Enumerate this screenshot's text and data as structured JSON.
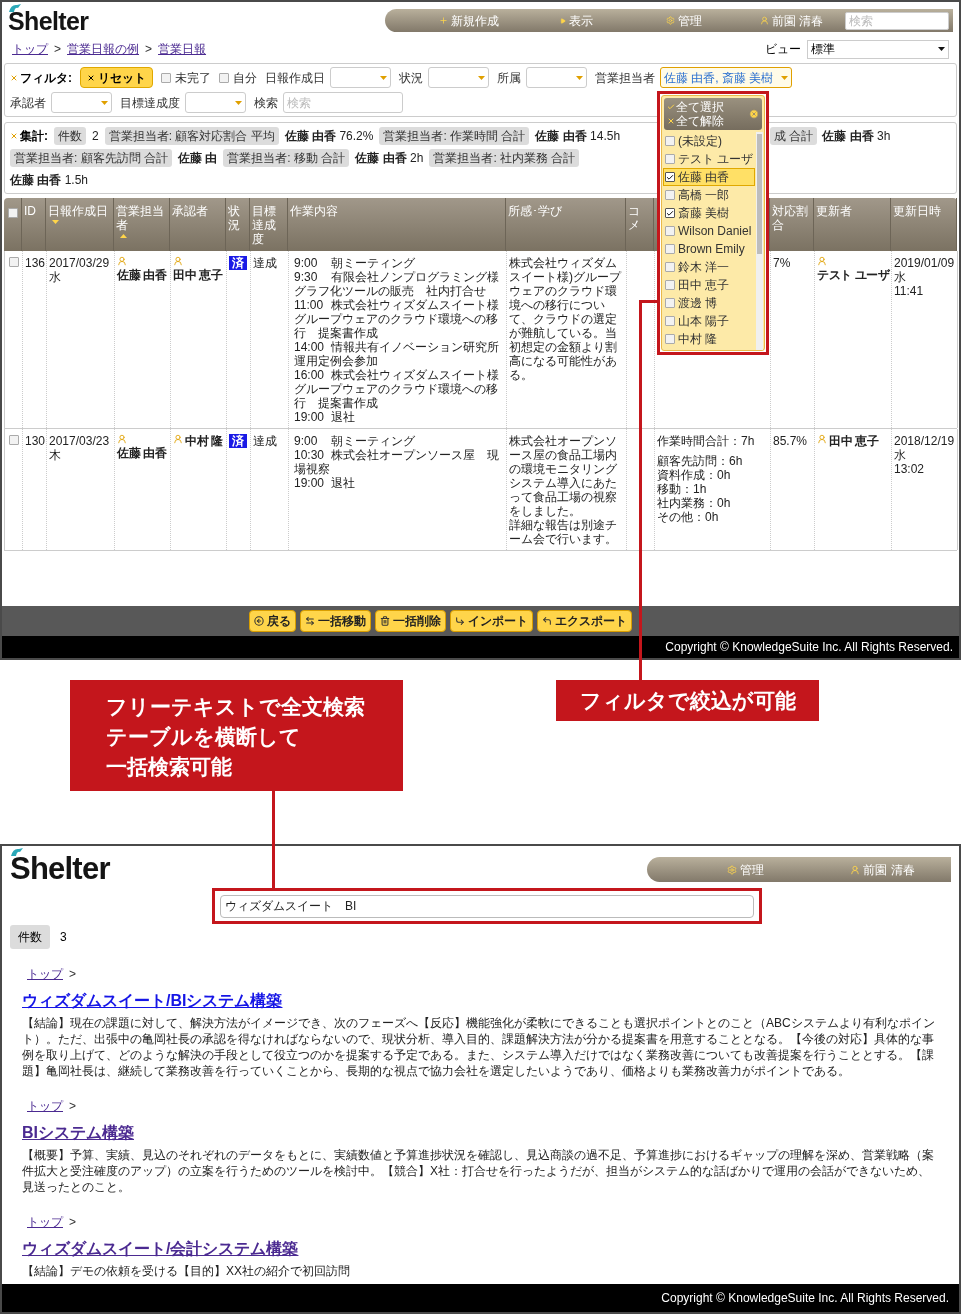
{
  "top_screen": {
    "logo": "Shelter",
    "nav": [
      {
        "kind": "new",
        "label": "新規作成"
      },
      {
        "kind": "view",
        "label": "表示"
      },
      {
        "kind": "admin",
        "label": "管理"
      },
      {
        "kind": "user",
        "label": "前園 清春"
      }
    ],
    "nav_search": {
      "placeholder": "検索"
    },
    "breadcrumb": [
      {
        "kind": "link",
        "text": "トップ"
      },
      {
        "kind": "separator",
        "text": ">"
      },
      {
        "kind": "link",
        "text": "営業日報の例"
      },
      {
        "kind": "separator",
        "text": ">"
      },
      {
        "kind": "link",
        "text": "営業日報"
      }
    ],
    "view": {
      "label": "ビュー",
      "value": "標準"
    },
    "filter": {
      "title": "フィルタ:",
      "reset": "リセット",
      "fields": [
        {
          "kind": "checkbox",
          "label": "未完了",
          "checked": false
        },
        {
          "kind": "checkbox",
          "label": "自分",
          "checked": false
        },
        {
          "kind": "select",
          "label": "日報作成日",
          "open": false
        },
        {
          "kind": "select",
          "label": "状況",
          "open": false
        },
        {
          "kind": "select",
          "label": "所属",
          "open": false
        },
        {
          "kind": "select",
          "label": "営業担当者",
          "value": "佐藤 由香, 斎藤 美樹",
          "open": true
        },
        {
          "kind": "select",
          "label": "承認者",
          "open": false
        },
        {
          "kind": "select",
          "label": "目標達成度",
          "open": false
        },
        {
          "kind": "text",
          "label": "検索",
          "placeholder": "検索"
        }
      ]
    },
    "dropdown": {
      "select_all": "全て選択",
      "clear_all": "全て解除",
      "options": [
        {
          "label": "(未設定)",
          "checked": false,
          "highlighted": false
        },
        {
          "label": "テスト ユーザ",
          "checked": false,
          "highlighted": false
        },
        {
          "label": "佐藤 由香",
          "checked": true,
          "highlighted": true
        },
        {
          "label": "高橋 一郎",
          "checked": false,
          "highlighted": false
        },
        {
          "label": "斎藤 美樹",
          "checked": true,
          "highlighted": false
        },
        {
          "label": "Wilson Daniel",
          "checked": false,
          "highlighted": false
        },
        {
          "label": "Brown Emily",
          "checked": false,
          "highlighted": false
        },
        {
          "label": "鈴木 洋一",
          "checked": false,
          "highlighted": false
        },
        {
          "label": "田中 恵子",
          "checked": false,
          "highlighted": false
        },
        {
          "label": "渡邊 博",
          "checked": false,
          "highlighted": false
        },
        {
          "label": "山本 陽子",
          "checked": false,
          "highlighted": false
        },
        {
          "label": "中村 隆",
          "checked": false,
          "highlighted": false
        }
      ]
    },
    "summary": {
      "title": "集計:",
      "row1_left": [
        {
          "kind": "chip",
          "text": "件数"
        },
        {
          "kind": "value",
          "text": "2"
        },
        {
          "kind": "chip",
          "text": "営業担当者: 顧客対応割合 平均"
        },
        {
          "kind": "value",
          "text": "**佐藤 由香** 76.2%"
        },
        {
          "kind": "chip",
          "text": "営業担当者: 作業時間 合計"
        },
        {
          "kind": "value",
          "text": "**佐藤 由香** 14.5h"
        },
        {
          "kind": "chip",
          "text": "営業担当者: 顧客先訪問 合計"
        },
        {
          "kind": "value",
          "text": "**佐藤 由**"
        }
      ],
      "row1_right": [
        {
          "kind": "chip",
          "text": "成 合計"
        },
        {
          "kind": "value",
          "text": "**佐藤 由香** 3h"
        }
      ],
      "row2": [
        {
          "kind": "chip",
          "text": "営業担当者: 移動 合計"
        },
        {
          "kind": "value",
          "text": "**佐藤 由香** 2h"
        },
        {
          "kind": "chip",
          "text": "営業担当者: 社内業務 合計"
        },
        {
          "kind": "value",
          "text": "**佐藤 由香** 1.5h"
        }
      ]
    },
    "table": {
      "all_checked": false,
      "columns": [
        {
          "label": "ID",
          "sorted": false
        },
        {
          "label": "日報作成日",
          "sorted": true,
          "ascending": false
        },
        {
          "label": "営業担当者",
          "sorted": true,
          "ascending": true
        },
        {
          "label": "承認者",
          "sorted": false
        },
        {
          "label": "状況",
          "sorted": false
        },
        {
          "label": "目標達成度",
          "sorted": false
        },
        {
          "label": "作業内容",
          "sorted": false
        },
        {
          "label": "所感･学び",
          "sorted": false
        },
        {
          "label": "コメ",
          "sorted": false
        },
        {
          "sorted": false
        },
        {
          "label": "対応割合",
          "sorted": false
        },
        {
          "label": "更新者",
          "sorted": false
        },
        {
          "label": "更新日時",
          "sorted": false
        }
      ],
      "rows": [
        {
          "checked": false,
          "id": "136",
          "date": "2017/03/29",
          "weekday": "水",
          "rep": "佐藤 由香",
          "approver": "田中 恵子",
          "status": {
            "kind": "done",
            "text": "済"
          },
          "achievement": "達成",
          "schedule": [
            {
              "time": "9:00",
              "lines": [
                "朝ミーティング"
              ]
            },
            {
              "time": "9:30",
              "lines": [
                "有限会社ノンプログラミング様",
                "グラフ化ツールの販売　社内打合せ"
              ]
            },
            {
              "time": "11:00",
              "lines": [
                "株式会社ウィズダムスイート様",
                "グループウェアのクラウド環境への移行　提案書作成"
              ]
            },
            {
              "time": "14:00",
              "lines": [
                "情報共有イノベーション研究所",
                "運用定例会参加"
              ]
            },
            {
              "time": "16:00",
              "lines": [
                "株式会社ウィズダムスイート様",
                "グループウェアのクラウド環境への移行　提案書作成"
              ]
            },
            {
              "time": "19:00",
              "lines": [
                "退社"
              ]
            }
          ],
          "notes": [
            "株式会社ウィズダムスイート様)グループウェアのクラウド環境への移行について、クラウドの選定が難航している。当初想定の金額より割高になる可能性がある。"
          ],
          "ratio": "7%",
          "updater": "テスト ユーザ",
          "updated_date": "2019/01/09 水",
          "updated_time": "11:41"
        },
        {
          "checked": false,
          "id": "130",
          "date": "2017/03/23",
          "weekday": "木",
          "rep": "佐藤 由香",
          "approver": "中村 隆",
          "status": {
            "kind": "done",
            "text": "済"
          },
          "achievement": "達成",
          "schedule": [
            {
              "time": "9:00",
              "lines": [
                "朝ミーティング"
              ]
            },
            {
              "time": "10:30",
              "lines": [
                "株式会社オープンソース屋　現場視察"
              ]
            },
            {
              "time": "19:00",
              "lines": [
                "退社"
              ]
            }
          ],
          "notes": [
            "株式会社オープンソース屋の食品工場内の環境モニタリングシステム導入にあたって食品工場の視察をしました。",
            "詳細な報告は別途チーム会で行います。"
          ],
          "hours": [
            "作業時間合計：7h",
            "顧客先訪問：6h",
            "資料作成：0h",
            "移動：1h",
            "社内業務：0h",
            "その他：0h"
          ],
          "ratio": "85.7%",
          "updater": "田中 恵子",
          "updated_date": "2018/12/19 水",
          "updated_time": "13:02"
        }
      ]
    },
    "actions": [
      {
        "kind": "back",
        "label": "戻る"
      },
      {
        "kind": "move",
        "label": "一括移動"
      },
      {
        "kind": "delete",
        "label": "一括削除"
      },
      {
        "kind": "import",
        "label": "インポート"
      },
      {
        "kind": "export",
        "label": "エクスポート"
      }
    ],
    "copyright": "Copyright © KnowledgeSuite Inc. All Rights Reserved."
  },
  "callouts": [
    {
      "lines": [
        "フリーテキストで全文検索",
        "テーブルを横断して",
        "一括検索可能"
      ]
    },
    {
      "lines": [
        "フィルタで絞込が可能"
      ]
    }
  ],
  "bottom_screen": {
    "logo": "Shelter",
    "nav": [
      {
        "kind": "admin",
        "label": "管理"
      },
      {
        "kind": "user",
        "label": "前園 清春"
      }
    ],
    "search": {
      "value": "ウィズダムスイート　BI"
    },
    "count": {
      "label": "件数",
      "value": "3"
    },
    "results": [
      {
        "breadcrumb": [
          {
            "kind": "link",
            "text": "トップ"
          },
          {
            "kind": "separator",
            "text": ">"
          }
        ],
        "title": "ウィズダムスイート/BIシステム構築",
        "visited": false,
        "summary": "【結論】現在の課題に対して、解決方法がイメージでき、次のフェーズへ【反応】機能強化が柔軟にできることも選択ポイントとのこと（ABCシステムより有利なポイント）。ただ、出張中の亀岡社長の承認を得なければならないので、現状分析、導入目的、課題解決方法が分かる提案書を用意することとなる。【今後の対応】具体的な事例を取り上げて、どのような解決の手段として役立つのかを提案する予定である。また、システム導入だけではなく業務改善についても改善提案を行うこととする。【課題】亀岡社長は、継続して業務改善を行っていくことから、長期的な視点で協力会社を選定したいようであり、価格よりも業務改善力がポイントである。"
      },
      {
        "breadcrumb": [
          {
            "kind": "link",
            "text": "トップ"
          },
          {
            "kind": "separator",
            "text": ">"
          }
        ],
        "title": "BIシステム構築",
        "visited": true,
        "summary": "【概要】予算、実績、見込のそれぞれのデータをもとに、実績数値と予算進捗状況を確認し、見込商談の過不足、予算進捗におけるギャップの理解を深め、営業戦略（案件拡大と受注確度のアップ）の立案を行うためのツールを検討中。【競合】X社：打合せを行ったようだが、担当がシステム的な話ばかりで運用の会話ができないため、見送ったとのこと。"
      },
      {
        "breadcrumb": [
          {
            "kind": "link",
            "text": "トップ"
          },
          {
            "kind": "separator",
            "text": ">"
          }
        ],
        "title": "ウィズダムスイート/会計システム構築",
        "visited": true,
        "summary": "【結論】デモの依頼を受ける【目的】XX社の紹介で初回訪問"
      }
    ],
    "copyright": "Copyright © KnowledgeSuite Inc. All Rights Reserved."
  }
}
